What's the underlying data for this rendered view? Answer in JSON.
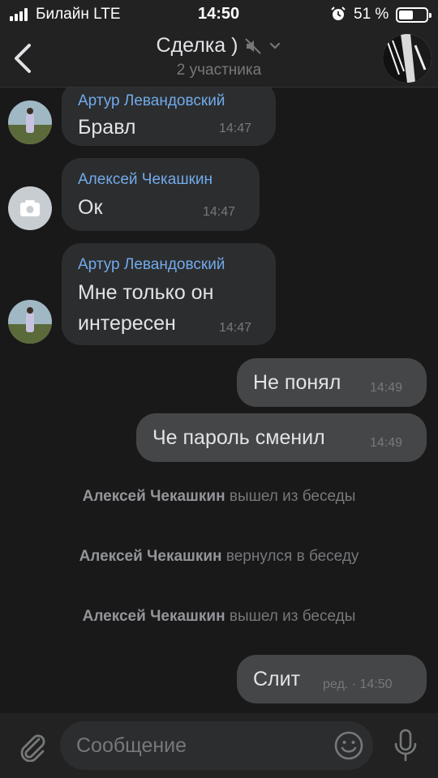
{
  "status_bar": {
    "carrier": "Билайн  LTE",
    "time": "14:50",
    "battery_percent": "51 %"
  },
  "header": {
    "title": "Сделка )",
    "subtitle": "2 участника",
    "icons": {
      "back": "chevron-left-icon",
      "mute": "muted-speaker-icon",
      "dropdown": "chevron-down-icon"
    }
  },
  "messages": [
    {
      "author": "Артур Левандовский",
      "text": "Бравл",
      "time": "14:47"
    },
    {
      "author": "Алексей Чекашкин",
      "text": "Ок",
      "time": "14:47"
    },
    {
      "author": "Артур Левандовский",
      "text_line1": "Мне только он",
      "text_line2": "интересен",
      "time": "14:47"
    },
    {
      "text": "Не понял",
      "time": "14:49"
    },
    {
      "text": "Че пароль сменил",
      "time": "14:49"
    },
    {
      "text": "Слит",
      "time": "ред. · 14:50"
    }
  ],
  "service_messages": [
    {
      "name": "Алексей Чекашкин",
      "action": "вышел из беседы"
    },
    {
      "name": "Алексей Чекашкин",
      "action": "вернулся в беседу"
    },
    {
      "name": "Алексей Чекашкин",
      "action": "вышел из беседы"
    }
  ],
  "composer": {
    "placeholder": "Сообщение",
    "icons": {
      "attach": "paperclip-icon",
      "emoji": "smiley-icon",
      "mic": "microphone-icon"
    }
  },
  "colors": {
    "background": "#19191a",
    "bars": "#222222",
    "incoming_bubble": "#2c2d2e",
    "outgoing_bubble": "#454647",
    "author_link": "#71aaeb",
    "secondary_text": "#76787a"
  }
}
